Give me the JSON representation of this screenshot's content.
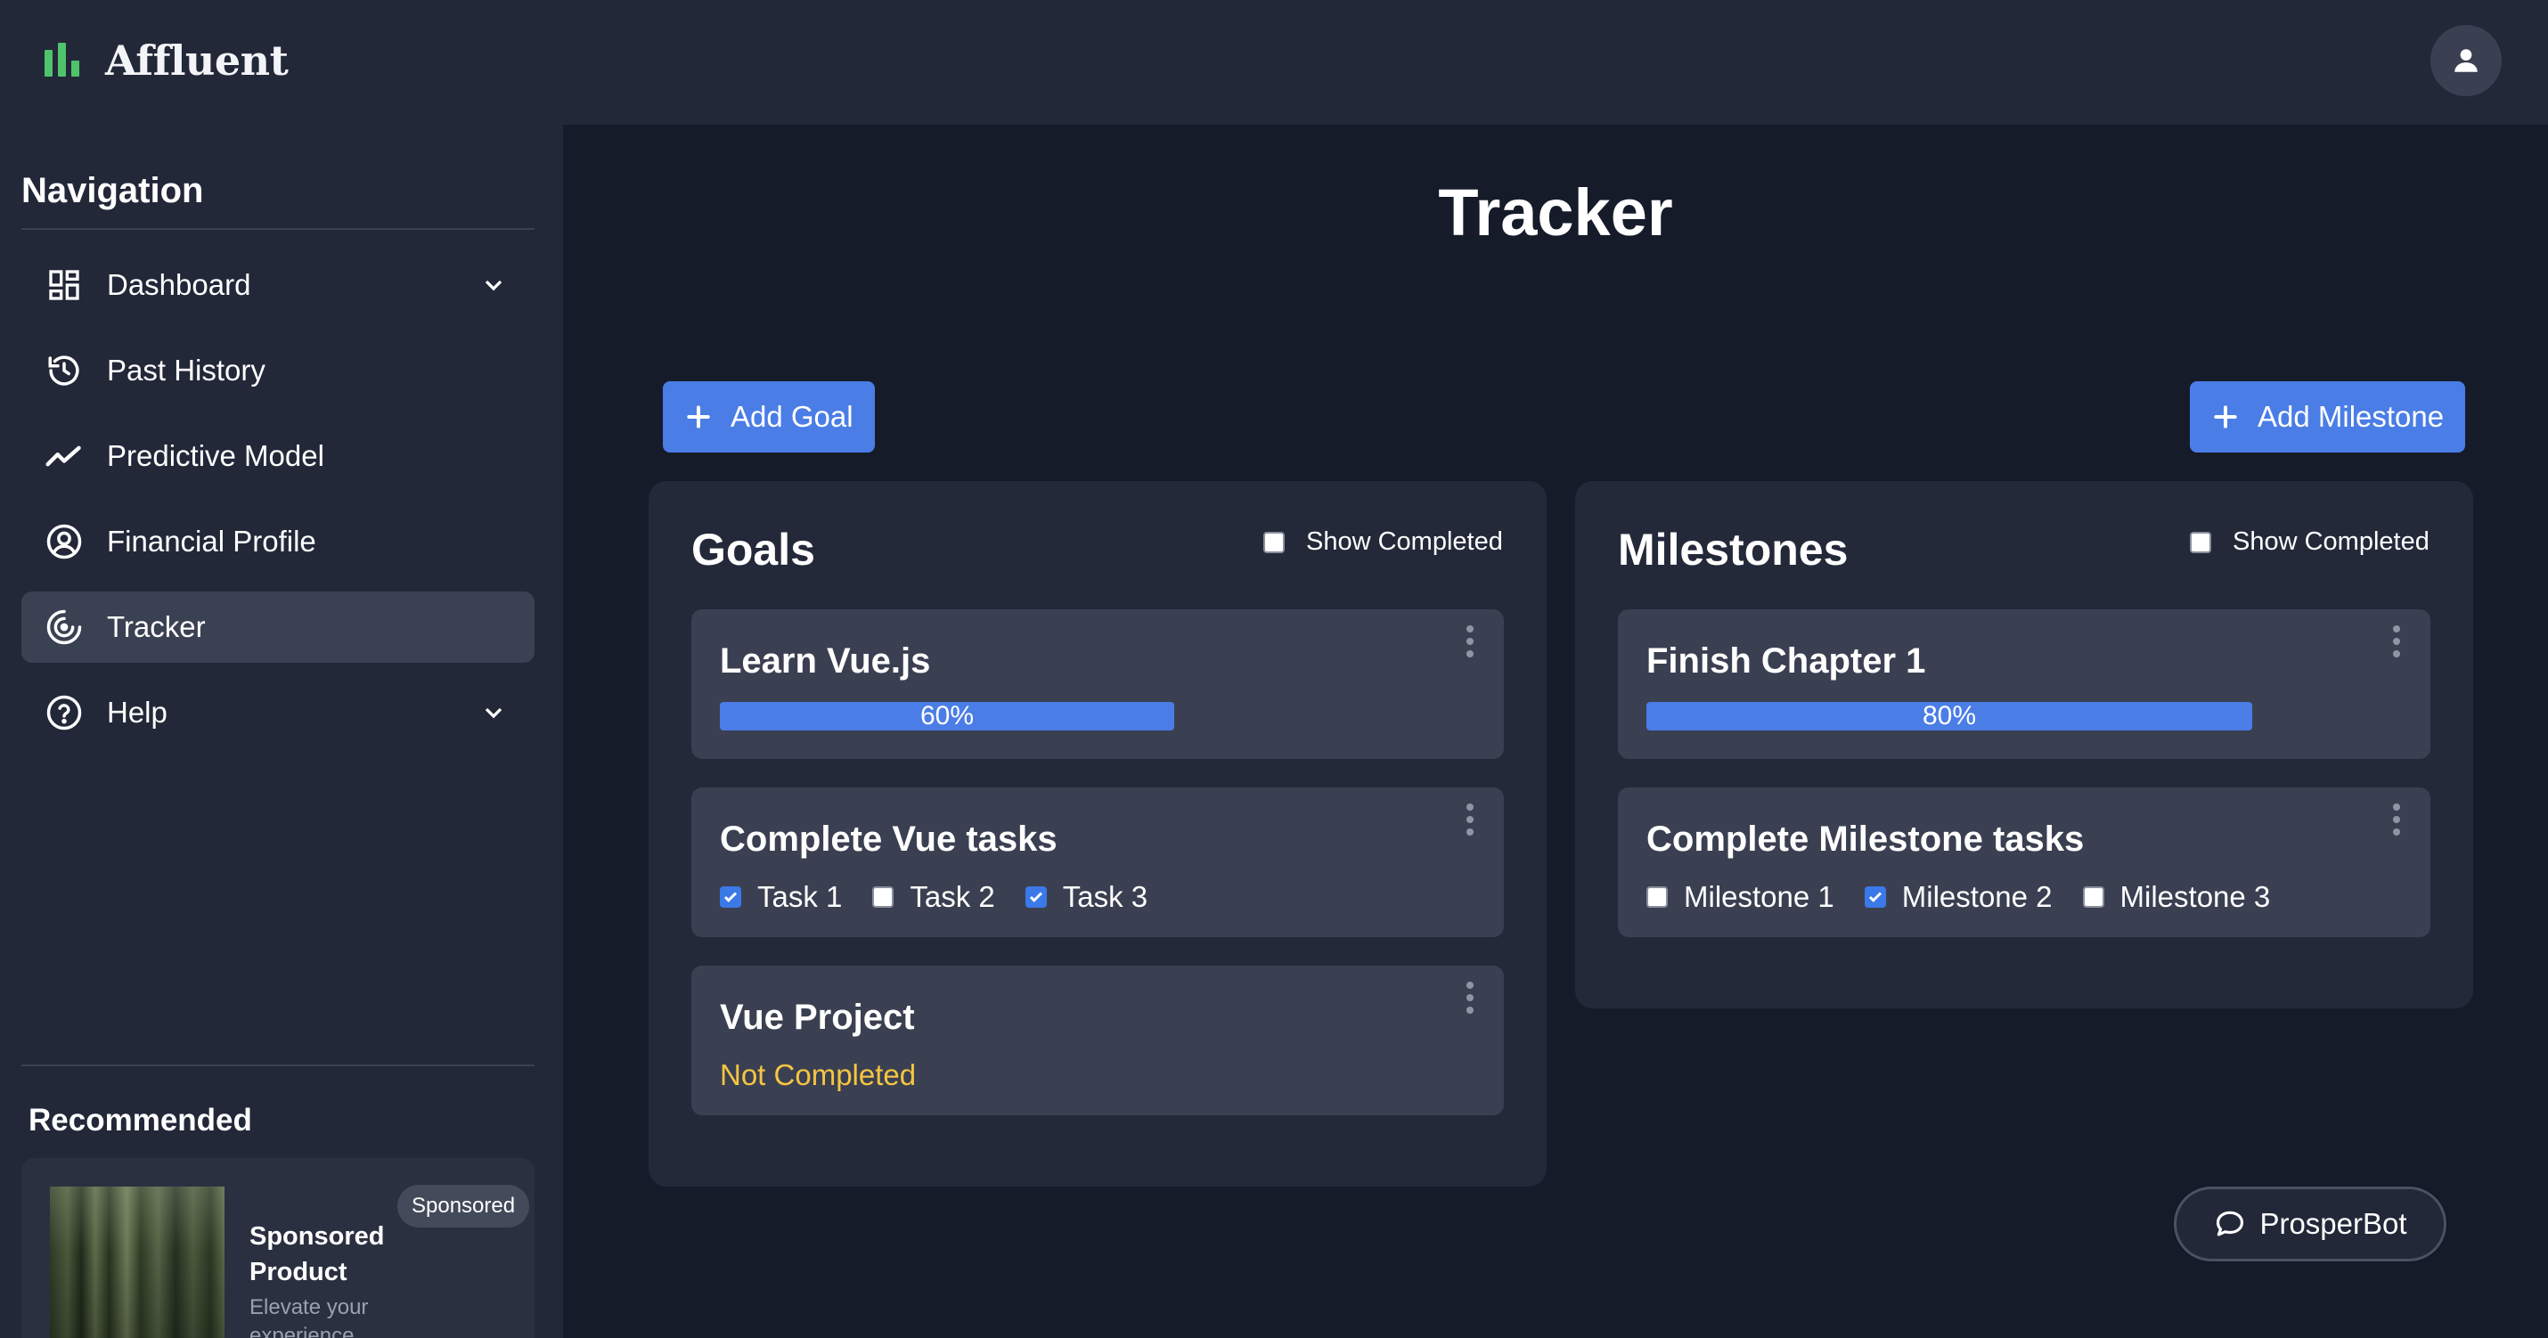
{
  "app": {
    "name": "Affluent",
    "brand_color": "#4fc36b",
    "accent_color": "#4a7de6"
  },
  "sidebar": {
    "title": "Navigation",
    "items": [
      {
        "label": "Dashboard",
        "icon": "dashboard-icon",
        "has_chevron": true,
        "active": false
      },
      {
        "label": "Past History",
        "icon": "history-icon",
        "has_chevron": false,
        "active": false
      },
      {
        "label": "Predictive Model",
        "icon": "trend-line-icon",
        "has_chevron": false,
        "active": false
      },
      {
        "label": "Financial Profile",
        "icon": "user-circle-icon",
        "has_chevron": false,
        "active": false
      },
      {
        "label": "Tracker",
        "icon": "target-icon",
        "has_chevron": false,
        "active": true
      },
      {
        "label": "Help",
        "icon": "help-circle-icon",
        "has_chevron": true,
        "active": false
      }
    ],
    "recommended": {
      "title": "Recommended",
      "badge": "Sponsored",
      "product_name": "Sponsored Product",
      "product_desc": "Elevate your experience"
    }
  },
  "main": {
    "title": "Tracker",
    "add_goal_label": "Add Goal",
    "add_milestone_label": "Add Milestone",
    "goals": {
      "title": "Goals",
      "show_completed_label": "Show Completed",
      "show_completed_checked": false,
      "progress_card": {
        "title": "Learn Vue.js",
        "progress": 0.6,
        "progress_label": "60%"
      },
      "tasks_card": {
        "title": "Complete Vue tasks",
        "tasks": [
          {
            "label": "Task 1",
            "checked": true
          },
          {
            "label": "Task 2",
            "checked": false
          },
          {
            "label": "Task 3",
            "checked": true
          }
        ]
      },
      "status_card": {
        "title": "Vue Project",
        "status": "Not Completed",
        "status_color": "#f5c542"
      }
    },
    "milestones": {
      "title": "Milestones",
      "show_completed_label": "Show Completed",
      "show_completed_checked": false,
      "progress_card": {
        "title": "Finish Chapter 1",
        "progress": 0.8,
        "progress_label": "80%"
      },
      "tasks_card": {
        "title": "Complete Milestone tasks",
        "tasks": [
          {
            "label": "Milestone 1",
            "checked": false
          },
          {
            "label": "Milestone 2",
            "checked": true
          },
          {
            "label": "Milestone 3",
            "checked": false
          }
        ]
      }
    },
    "bot_label": "ProsperBot"
  }
}
